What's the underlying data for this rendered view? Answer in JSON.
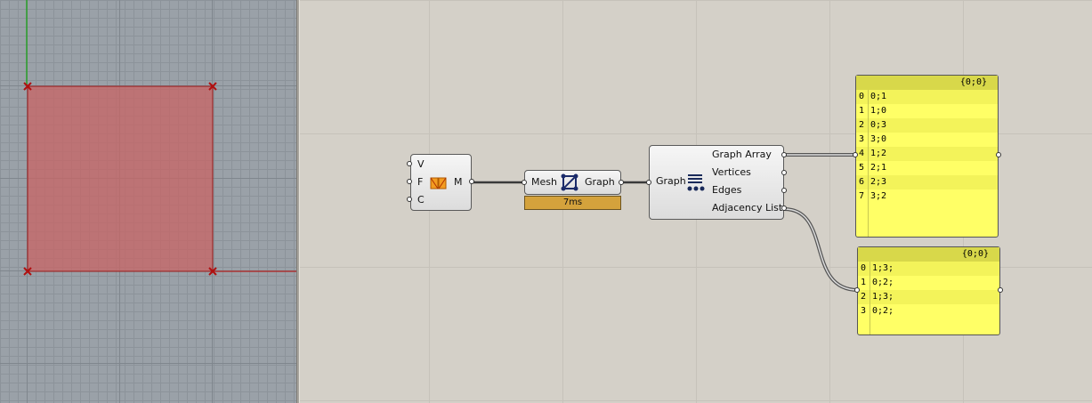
{
  "canvas": {
    "mesh_comp": {
      "inputs": [
        "V",
        "F",
        "C"
      ],
      "output": "M"
    },
    "graph_comp": {
      "input": "Mesh",
      "output": "Graph",
      "timing": "7ms"
    },
    "deconstruct": {
      "input": "Graph",
      "outputs": [
        "Graph Array",
        "Vertices",
        "Edges",
        "Adjacency List"
      ]
    },
    "panel1": {
      "header": "{0;0}",
      "rows": [
        [
          "0",
          "0;1"
        ],
        [
          "1",
          "1;0"
        ],
        [
          "2",
          "0;3"
        ],
        [
          "3",
          "3;0"
        ],
        [
          "4",
          "1;2"
        ],
        [
          "5",
          "2;1"
        ],
        [
          "6",
          "2;3"
        ],
        [
          "7",
          "3;2"
        ]
      ]
    },
    "panel2": {
      "header": "{0;0}",
      "rows": [
        [
          "0",
          "1;3;"
        ],
        [
          "1",
          "0;2;"
        ],
        [
          "2",
          "1;3;"
        ],
        [
          "3",
          "0;2;"
        ]
      ]
    }
  },
  "colors": {
    "panel_bg": "#ffff66",
    "mesh_fill": "#c87a7a",
    "accent": "#d4a23c"
  }
}
